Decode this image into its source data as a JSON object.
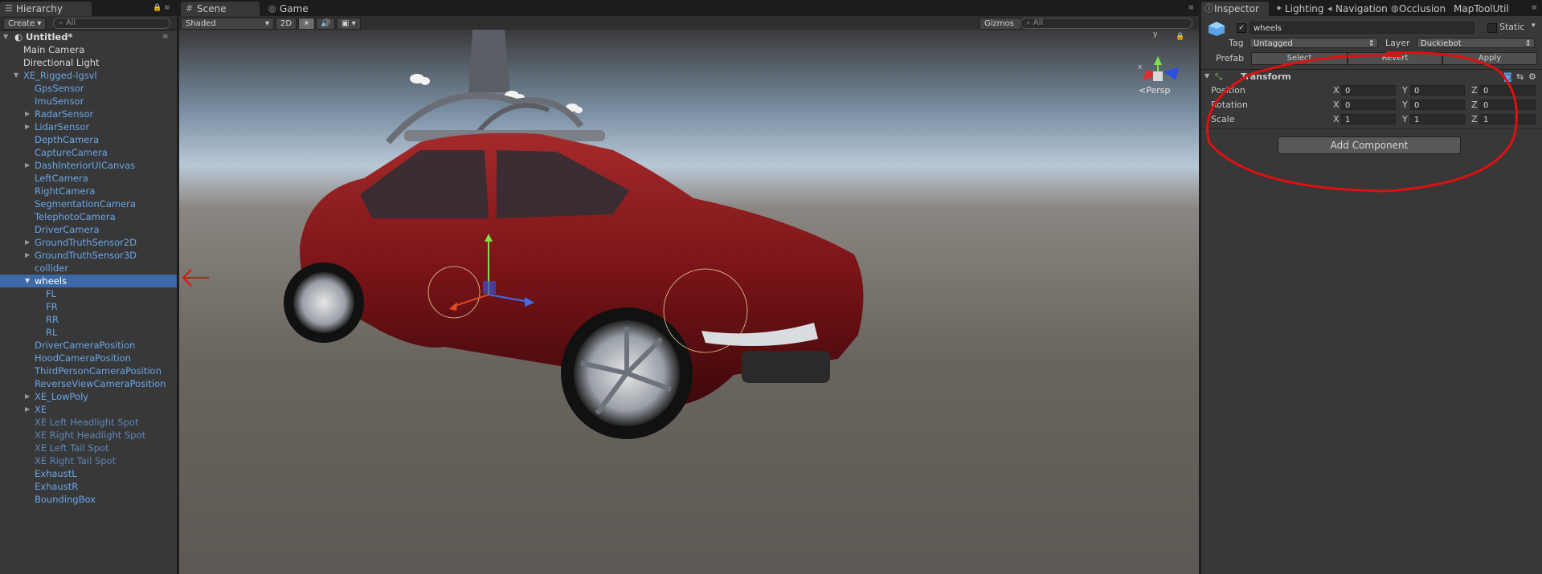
{
  "hierarchy": {
    "tab_label": "Hierarchy",
    "create_label": "Create",
    "search_placeholder": "All",
    "scene_name": "Untitled*",
    "items": [
      {
        "label": "Main Camera"
      },
      {
        "label": "Directional Light"
      },
      {
        "label": "XE_Rigged-lgsvl"
      },
      {
        "label": "GpsSensor"
      },
      {
        "label": "ImuSensor"
      },
      {
        "label": "RadarSensor"
      },
      {
        "label": "LidarSensor"
      },
      {
        "label": "DepthCamera"
      },
      {
        "label": "CaptureCamera"
      },
      {
        "label": "DashInteriorUICanvas"
      },
      {
        "label": "LeftCamera"
      },
      {
        "label": "RightCamera"
      },
      {
        "label": "SegmentationCamera"
      },
      {
        "label": "TelephotoCamera"
      },
      {
        "label": "DriverCamera"
      },
      {
        "label": "GroundTruthSensor2D"
      },
      {
        "label": "GroundTruthSensor3D"
      },
      {
        "label": "collider"
      },
      {
        "label": "wheels"
      },
      {
        "label": "FL"
      },
      {
        "label": "FR"
      },
      {
        "label": "RR"
      },
      {
        "label": "RL"
      },
      {
        "label": "DriverCameraPosition"
      },
      {
        "label": "HoodCameraPosition"
      },
      {
        "label": "ThirdPersonCameraPosition"
      },
      {
        "label": "ReverseViewCameraPosition"
      },
      {
        "label": "XE_LowPoly"
      },
      {
        "label": "XE"
      },
      {
        "label": "XE Left Headlight Spot"
      },
      {
        "label": "XE Right Headlight Spot"
      },
      {
        "label": "XE Left Tail Spot"
      },
      {
        "label": "XE Right Tail Spot"
      },
      {
        "label": "ExhaustL"
      },
      {
        "label": "ExhaustR"
      },
      {
        "label": "BoundingBox"
      }
    ]
  },
  "scene": {
    "tabs": {
      "scene": "Scene",
      "game": "Game"
    },
    "shading_mode": "Shaded",
    "mode_2d": "2D",
    "gizmos_label": "Gizmos",
    "search_placeholder": "All",
    "persp_label": "<Persp",
    "axis_x": "x",
    "axis_y": "y",
    "sky_color": "#b8c8d6",
    "ground_color": "#6b655f",
    "car_color": "#7a1418",
    "annotation_color": "#e01010"
  },
  "inspector": {
    "tabs": {
      "inspector": "Inspector",
      "lighting": "Lighting",
      "navigation": "Navigation",
      "occlusion": "Occlusion",
      "maptool": "MapToolUtil"
    },
    "object_name": "wheels",
    "static_label": "Static",
    "tag_label": "Tag",
    "tag_value": "Untagged",
    "layer_label": "Layer",
    "layer_value": "Duckiebot",
    "prefab_label": "Prefab",
    "prefab_select": "Select",
    "prefab_revert": "Revert",
    "prefab_apply": "Apply",
    "transform_title": "Transform",
    "position_label": "Position",
    "rotation_label": "Rotation",
    "scale_label": "Scale",
    "x_label": "X",
    "y_label": "Y",
    "z_label": "Z",
    "position": {
      "x": "0",
      "y": "0",
      "z": "0"
    },
    "rotation": {
      "x": "0",
      "y": "0",
      "z": "0"
    },
    "scale": {
      "x": "1",
      "y": "1",
      "z": "1"
    },
    "add_component_label": "Add Component"
  }
}
